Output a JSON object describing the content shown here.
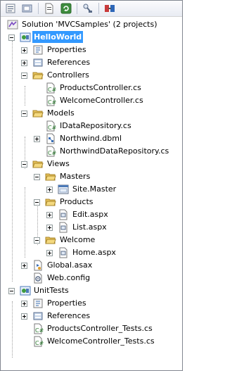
{
  "toolbar": {
    "buttons": [
      {
        "name": "properties-icon"
      },
      {
        "name": "show-all-files-icon"
      },
      {
        "name": "refresh-icon"
      },
      {
        "name": "view-code-icon"
      },
      {
        "name": "class-diagram-icon"
      }
    ]
  },
  "tree": {
    "solution_label": "Solution 'MVCSamples' (2 projects)",
    "hello_world": "HelloWorld",
    "properties": "Properties",
    "references": "References",
    "controllers": "Controllers",
    "products_controller": "ProductsController.cs",
    "welcome_controller": "WelcomeController.cs",
    "models": "Models",
    "idata_repository": "IDataRepository.cs",
    "northwind_dbml": "Northwind.dbml",
    "northwind_data_repository": "NorthwindDataRepository.cs",
    "views": "Views",
    "masters": "Masters",
    "site_master": "Site.Master",
    "products": "Products",
    "edit_aspx": "Edit.aspx",
    "list_aspx": "List.aspx",
    "welcome": "Welcome",
    "home_aspx": "Home.aspx",
    "global_asax": "Global.asax",
    "web_config": "Web.config",
    "unit_tests": "UnitTests",
    "ut_properties": "Properties",
    "ut_references": "References",
    "products_controller_tests": "ProductsController_Tests.cs",
    "welcome_controller_tests": "WelcomeController_Tests.cs"
  },
  "colors": {
    "selection": "#3399ff",
    "folder": "#e8c35a",
    "cs_file": "#2e7d32"
  }
}
